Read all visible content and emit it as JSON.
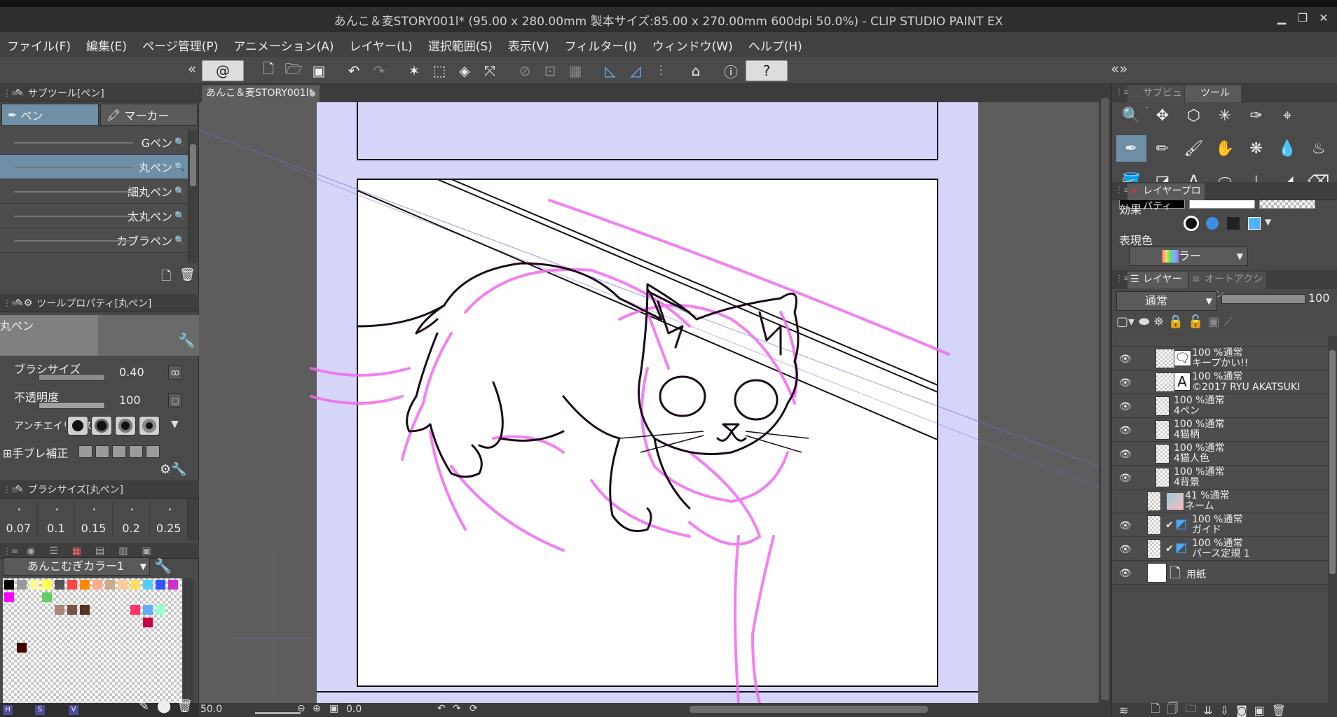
{
  "window": {
    "title": "あんこ＆麦STORY001l* (95.00 x 280.00mm 製本サイズ:85.00 x 270.00mm 600dpi 50.0%)  - CLIP STUDIO PAINT EX",
    "minimize": "▁",
    "maximize": "❐",
    "close": "✕"
  },
  "menu": [
    "ファイル(F)",
    "編集(E)",
    "ページ管理(P)",
    "アニメーション(A)",
    "レイヤー(L)",
    "選択範囲(S)",
    "表示(V)",
    "フィルター(I)",
    "ウィンドウ(W)",
    "ヘルプ(H)"
  ],
  "toolbar": {
    "collapse_left": "«",
    "collapse_right": "«»",
    "icons": [
      "spiral-icon",
      "new-icon",
      "open-icon",
      "save-icon",
      "undo-icon",
      "redo-icon",
      "clear-icon",
      "fill-icon",
      "transform-icon",
      "deselect-icon",
      "invert-icon",
      "grid-icon",
      "ruler-icon",
      "snap-icon",
      "perspective-icon",
      "view-icon",
      "info-icon",
      "help-icon"
    ]
  },
  "subtool_panel": {
    "title": "サブツール[ペン]",
    "tabs": [
      "ペン",
      "マーカー"
    ],
    "brushes": [
      {
        "name": "Gペン",
        "selected": false
      },
      {
        "name": "丸ペン",
        "selected": true
      },
      {
        "name": "細丸ペン",
        "selected": false
      },
      {
        "name": "太丸ペン",
        "selected": false
      },
      {
        "name": "カブラペン",
        "selected": false
      }
    ]
  },
  "tool_property": {
    "title": "ツールプロパティ[丸ペン]",
    "preset_name": "丸ペン",
    "brush_size_label": "ブラシサイズ",
    "brush_size_value": "0.40",
    "opacity_label": "不透明度",
    "opacity_value": "100",
    "antialias_label": "アンチエイリアス",
    "stabilization_label": "手ブレ補正"
  },
  "brush_size_panel": {
    "title": "ブラシサイズ[丸ペン]",
    "sizes": [
      "0.07",
      "0.1",
      "0.15",
      "0.2",
      "0.25"
    ]
  },
  "color_set": {
    "name": "あんこむぎカラー1",
    "bottom_letters": [
      "H",
      "S",
      "V"
    ],
    "swatches": [
      "#000000",
      "#9a9a9a",
      "#fff7a0",
      "#ffff55",
      "#555555",
      "#ff4444",
      "#ff8800",
      "#ffaa88",
      "#ccaa88",
      "#ffcc99",
      "#ffdd66",
      "#55ccff",
      "#3355ff",
      "#cc33cc",
      "#ff00ff",
      "#66cc66",
      "#aa8877",
      "#775544",
      "#553322",
      "#ff3366",
      "#66aaff",
      "#99ffcc",
      "#cc0044",
      "#440000"
    ]
  },
  "document": {
    "tab_name": "あんこ＆麦STORY001l*",
    "zoom": "50.0",
    "rotation": "0.0"
  },
  "right_panel": {
    "tabs_top": [
      "サブビュー",
      "ツール"
    ],
    "colors": {
      "main": "#000000",
      "sub": "#ffffff"
    },
    "layer_property_title": "レイヤープロパティ",
    "effect_label": "効果",
    "expression_color_label": "表現色",
    "expression_color_value": "カラー",
    "layer_tabs": [
      "レイヤー",
      "オートアクション"
    ],
    "blend_mode": "通常",
    "opacity": "100"
  },
  "layers": [
    {
      "opacity": "100 %通常",
      "name": "キープかい!!",
      "type": "balloon",
      "visible": true
    },
    {
      "opacity": "100 %通常",
      "name": "©2017 RYU AKATSUKI",
      "type": "text",
      "visible": true
    },
    {
      "opacity": "100 %通常",
      "name": "4ペン",
      "type": "raster",
      "visible": true
    },
    {
      "opacity": "100 %通常",
      "name": "4猫柄",
      "type": "raster",
      "visible": true
    },
    {
      "opacity": "100 %通常",
      "name": "4猫人色",
      "type": "raster",
      "visible": true
    },
    {
      "opacity": "100 %通常",
      "name": "4背景",
      "type": "raster",
      "visible": true
    },
    {
      "opacity": "41 %通常",
      "name": "ネーム",
      "type": "raster",
      "visible": false
    },
    {
      "opacity": "100 %通常",
      "name": "ガイド",
      "type": "ruler",
      "visible": true
    },
    {
      "opacity": "100 %通常",
      "name": "パース定規 1",
      "type": "ruler",
      "visible": true
    },
    {
      "opacity": "",
      "name": "用紙",
      "type": "paper",
      "visible": true
    }
  ]
}
